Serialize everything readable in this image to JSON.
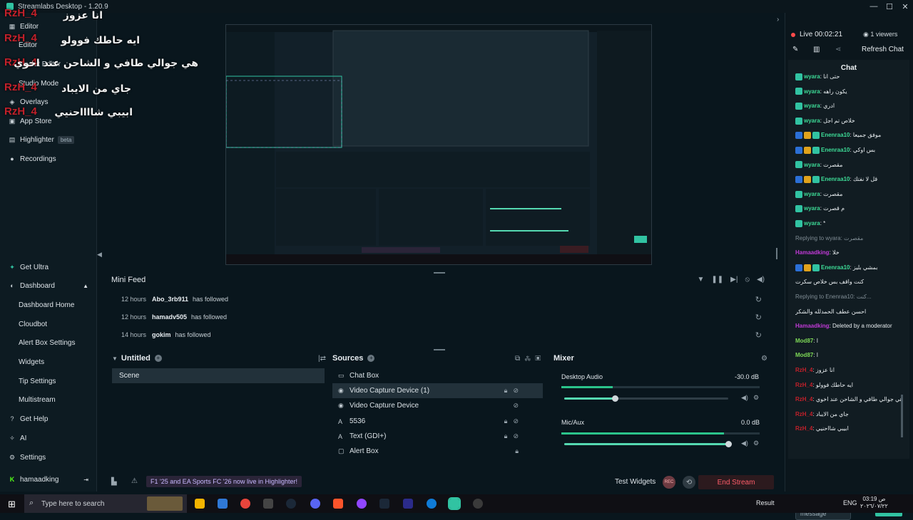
{
  "window": {
    "title": "Streamlabs Desktop - 1.20.9"
  },
  "overlay": {
    "lines": [
      {
        "name": "RzH_4",
        "text": "انا عزوز"
      },
      {
        "name": "RzH_4",
        "text": "ايه حاطك فوولو"
      },
      {
        "name": "RzH_4",
        "text": "هي جوالي طافي و الشاحن عند اخوي"
      },
      {
        "name": "RzH_4",
        "text": "جاي من الايباد"
      },
      {
        "name": "RzH_4",
        "text": "ابيبي شااااحنيي"
      }
    ]
  },
  "sidebar": {
    "items": [
      {
        "label": "Editor",
        "icon": "editor-icon"
      },
      {
        "label": "Editor",
        "icon": "editor-icon"
      },
      {
        "label": "Layout Editor",
        "icon": "layout-icon"
      },
      {
        "label": "Studio Mode",
        "icon": "studio-icon"
      },
      {
        "label": "Overlays",
        "icon": "overlays-icon"
      },
      {
        "label": "App Store",
        "icon": "store-icon"
      },
      {
        "label": "Highlighter",
        "icon": "highlighter-icon",
        "badge": "beta"
      },
      {
        "label": "Recordings",
        "icon": "recordings-icon"
      }
    ],
    "bottom": [
      {
        "label": "Get Ultra",
        "icon": "ultra-icon"
      },
      {
        "label": "Dashboard",
        "icon": "dashboard-icon"
      },
      {
        "label": "Dashboard Home",
        "sub": true
      },
      {
        "label": "Cloudbot",
        "sub": true
      },
      {
        "label": "Alert Box Settings",
        "sub": true
      },
      {
        "label": "Widgets",
        "sub": true
      },
      {
        "label": "Tip Settings",
        "sub": true
      },
      {
        "label": "Multistream",
        "sub": true
      },
      {
        "label": "Get Help",
        "icon": "help-icon"
      },
      {
        "label": "AI",
        "icon": "ai-icon"
      },
      {
        "label": "Settings",
        "icon": "settings-icon"
      },
      {
        "label": "hamaadking",
        "icon": "kick-icon"
      }
    ]
  },
  "minifeed": {
    "title": "Mini Feed",
    "rows": [
      {
        "time": "12 hours",
        "user": "Abo_3rb911",
        "action": "has followed"
      },
      {
        "time": "12 hours",
        "user": "hamadv505",
        "action": "has followed"
      },
      {
        "time": "14 hours",
        "user": "gokim",
        "action": "has followed"
      }
    ]
  },
  "scenes": {
    "title": "Untitled",
    "items": [
      "Scene"
    ]
  },
  "sources": {
    "title": "Sources",
    "items": [
      {
        "label": "Chat Box",
        "icon": "chat-icon"
      },
      {
        "label": "Video Capture Device (1)",
        "icon": "camera-icon",
        "selected": true
      },
      {
        "label": "Video Capture Device",
        "icon": "camera-icon"
      },
      {
        "label": "5536",
        "icon": "text-icon"
      },
      {
        "label": "Text (GDI+)",
        "icon": "text-icon"
      },
      {
        "label": "Alert Box",
        "icon": "alert-icon"
      }
    ]
  },
  "mixer": {
    "title": "Mixer",
    "channels": [
      {
        "name": "Desktop Audio",
        "db": "-30.0 dB",
        "level": 0.26,
        "volume": 0.31
      },
      {
        "name": "Mic/Aux",
        "db": "0.0 dB",
        "level": 0.82,
        "volume": 1.0
      }
    ]
  },
  "bottom": {
    "news": "F1 '25 and EA Sports FC '26 now live in Highlighter!",
    "test_widgets": "Test Widgets",
    "end_stream": "End Stream",
    "rec": "REC"
  },
  "chat": {
    "live": "Live 00:02:21",
    "viewers": "1 viewers",
    "refresh": "Refresh Chat",
    "title": "Chat",
    "send_placeholder": "Send a message",
    "send_button": "Chat",
    "messages": [
      {
        "name": "wyara",
        "text": "حتى انا",
        "color": "#3ddc97"
      },
      {
        "name": "wyara",
        "text": "يكون راهه",
        "color": "#3ddc97"
      },
      {
        "name": "wyara",
        "text": "ادري",
        "color": "#3ddc97"
      },
      {
        "name": "wyara",
        "text": "خلاص تم اجل",
        "color": "#3ddc97"
      },
      {
        "name": "Enenraa10",
        "text": "موفق جميعا",
        "color": "#3ddc97",
        "badges": true
      },
      {
        "name": "Enenraa10",
        "text": "بس اوكي",
        "color": "#3ddc97",
        "badges": true
      },
      {
        "name": "wyara",
        "text": "مقصرت",
        "color": "#3ddc97"
      },
      {
        "name": "Enenraa10",
        "text": "قل لا نفتك",
        "color": "#3ddc97",
        "badges": true
      },
      {
        "name": "wyara",
        "text": "مقصرت",
        "color": "#3ddc97"
      },
      {
        "name": "wyara",
        "text": "م قصرت",
        "color": "#3ddc97"
      },
      {
        "name": "wyara",
        "text": "*",
        "color": "#3ddc97"
      },
      {
        "reply": "Replying to wyara: مقصرت"
      },
      {
        "name": "Hamaadking",
        "text": "خلا",
        "color": "#c03ad6"
      },
      {
        "name": "Enenraa10",
        "text": "بمشي بليز",
        "color": "#3ddc97",
        "badges": true
      },
      {
        "text": "كنت واقف بس خلاص سكرت"
      },
      {
        "reply": "Replying to Enenraa10: كنت..."
      },
      {
        "text": "احسن عطف الحمدلله والشكر"
      },
      {
        "name": "Hamaadking",
        "text": "Deleted by a moderator",
        "color": "#c03ad6"
      },
      {
        "name": "Mod87",
        "text": "ا",
        "color": "#7ed957"
      },
      {
        "name": "Mod87",
        "text": "ا",
        "color": "#7ed957"
      },
      {
        "name": "RzH_4",
        "text": "انا عزوز",
        "color": "#c2202a"
      },
      {
        "name": "RzH_4",
        "text": "ايه حاطك فوولو",
        "color": "#c2202a"
      },
      {
        "name": "RzH_4",
        "text": "هي جوالي طافي و الشاحن عند اخوي",
        "color": "#c2202a"
      },
      {
        "name": "RzH_4",
        "text": "جاي من الايباد",
        "color": "#c2202a"
      },
      {
        "name": "RzH_4",
        "text": "ابيبي شااحنيي",
        "color": "#c2202a"
      }
    ]
  },
  "taskbar": {
    "search_placeholder": "Type here to search",
    "tray_text": "Result",
    "lang": "ENG",
    "time": "03:19 ص",
    "date": "٢٠٢٦/٠٧/٢٢"
  }
}
